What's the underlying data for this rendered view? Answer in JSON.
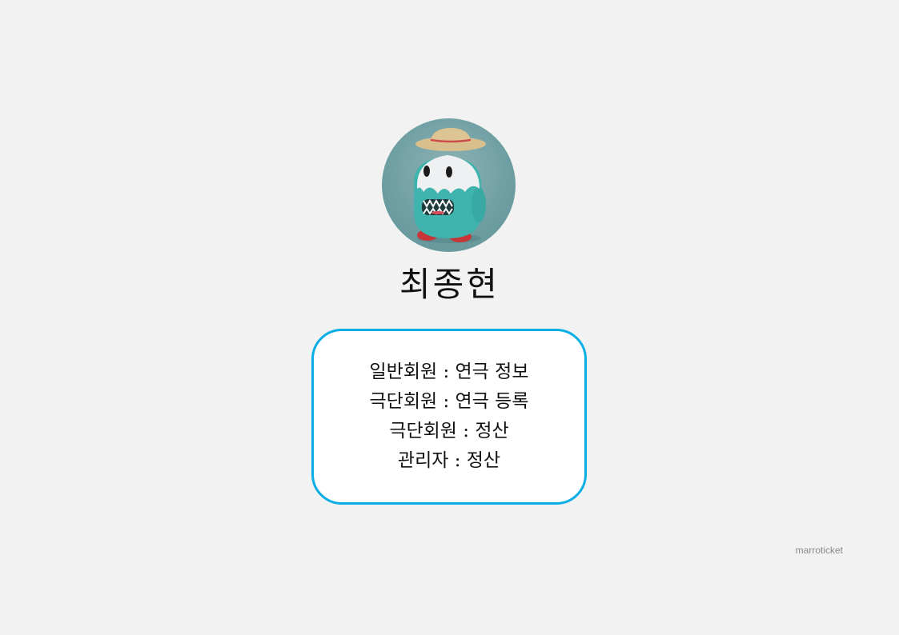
{
  "profile": {
    "avatar_icon": "mascot-avatar-icon",
    "name": "최종현"
  },
  "info": {
    "lines": [
      "일반회원 : 연극 정보",
      "극단회원 : 연극 등록",
      "극단회원 : 정산",
      "관리자 : 정산"
    ]
  },
  "footer": {
    "brand": "marroticket"
  },
  "colors": {
    "background": "#f2f2f2",
    "box_border": "#0aaee6",
    "text": "#111111",
    "brand_text": "#8a8a8a"
  }
}
